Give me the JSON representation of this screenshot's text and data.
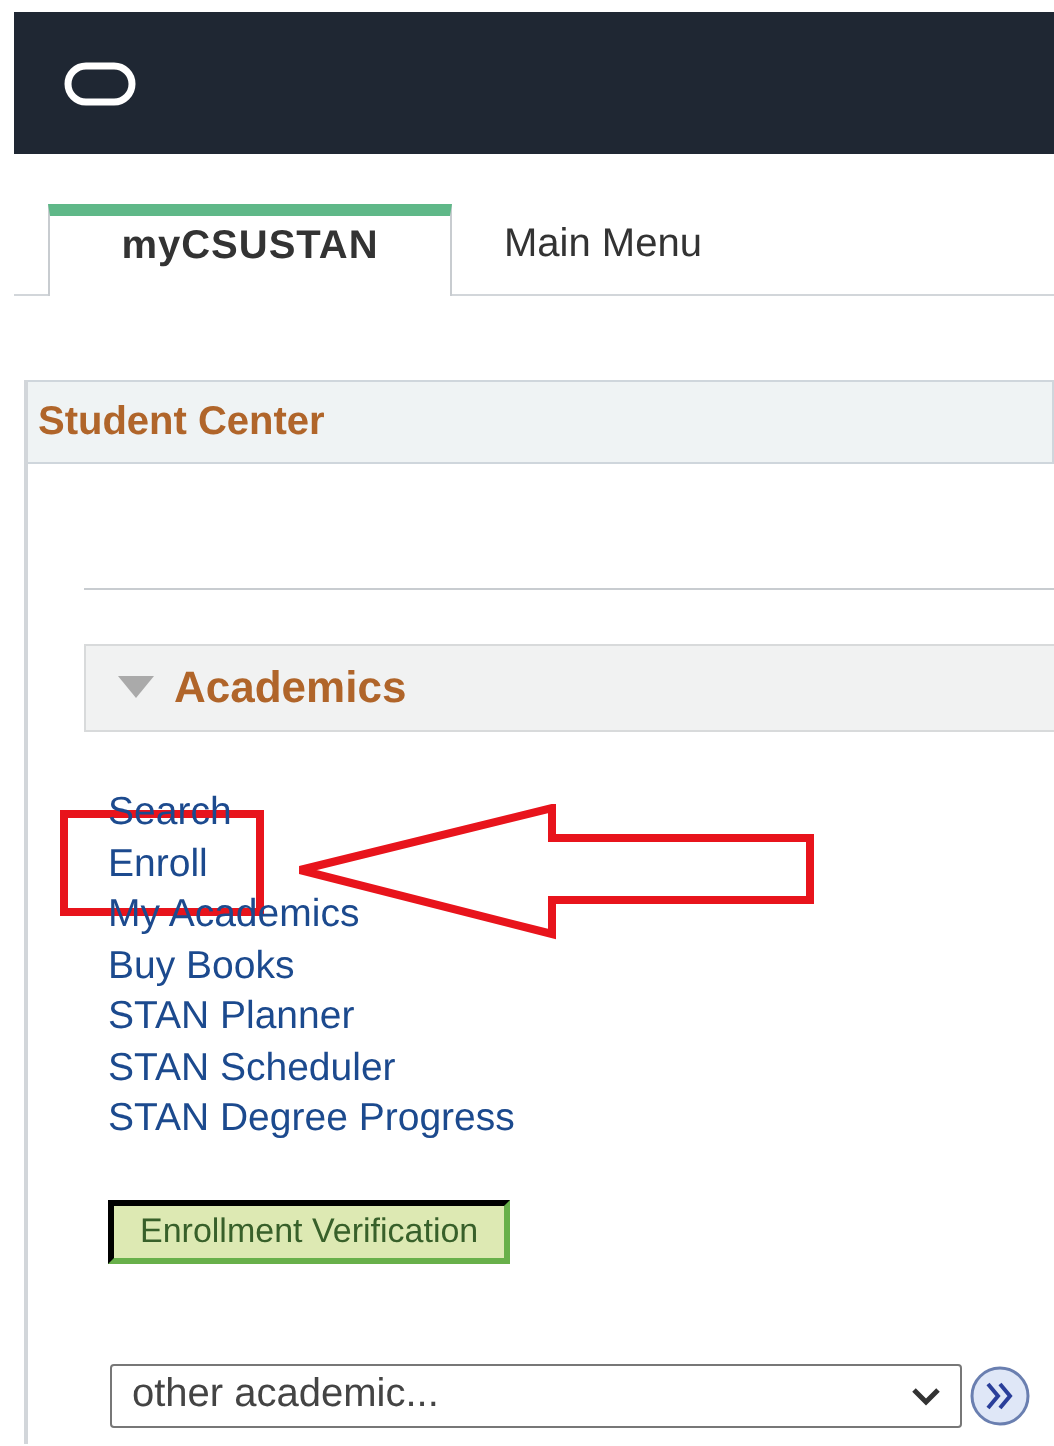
{
  "tabs": [
    {
      "label": "myCSUSTAN",
      "selected": true
    },
    {
      "label": "Main Menu",
      "selected": false
    }
  ],
  "panel": {
    "title": "Student Center",
    "section": {
      "title": "Academics",
      "expanded": true,
      "links": [
        "Search",
        "Enroll",
        "My Academics",
        "Buy Books",
        "STAN Planner",
        "STAN Scheduler",
        "STAN Degree Progress"
      ],
      "button": "Enrollment Verification",
      "dropdown": {
        "value": "other academic..."
      }
    }
  }
}
